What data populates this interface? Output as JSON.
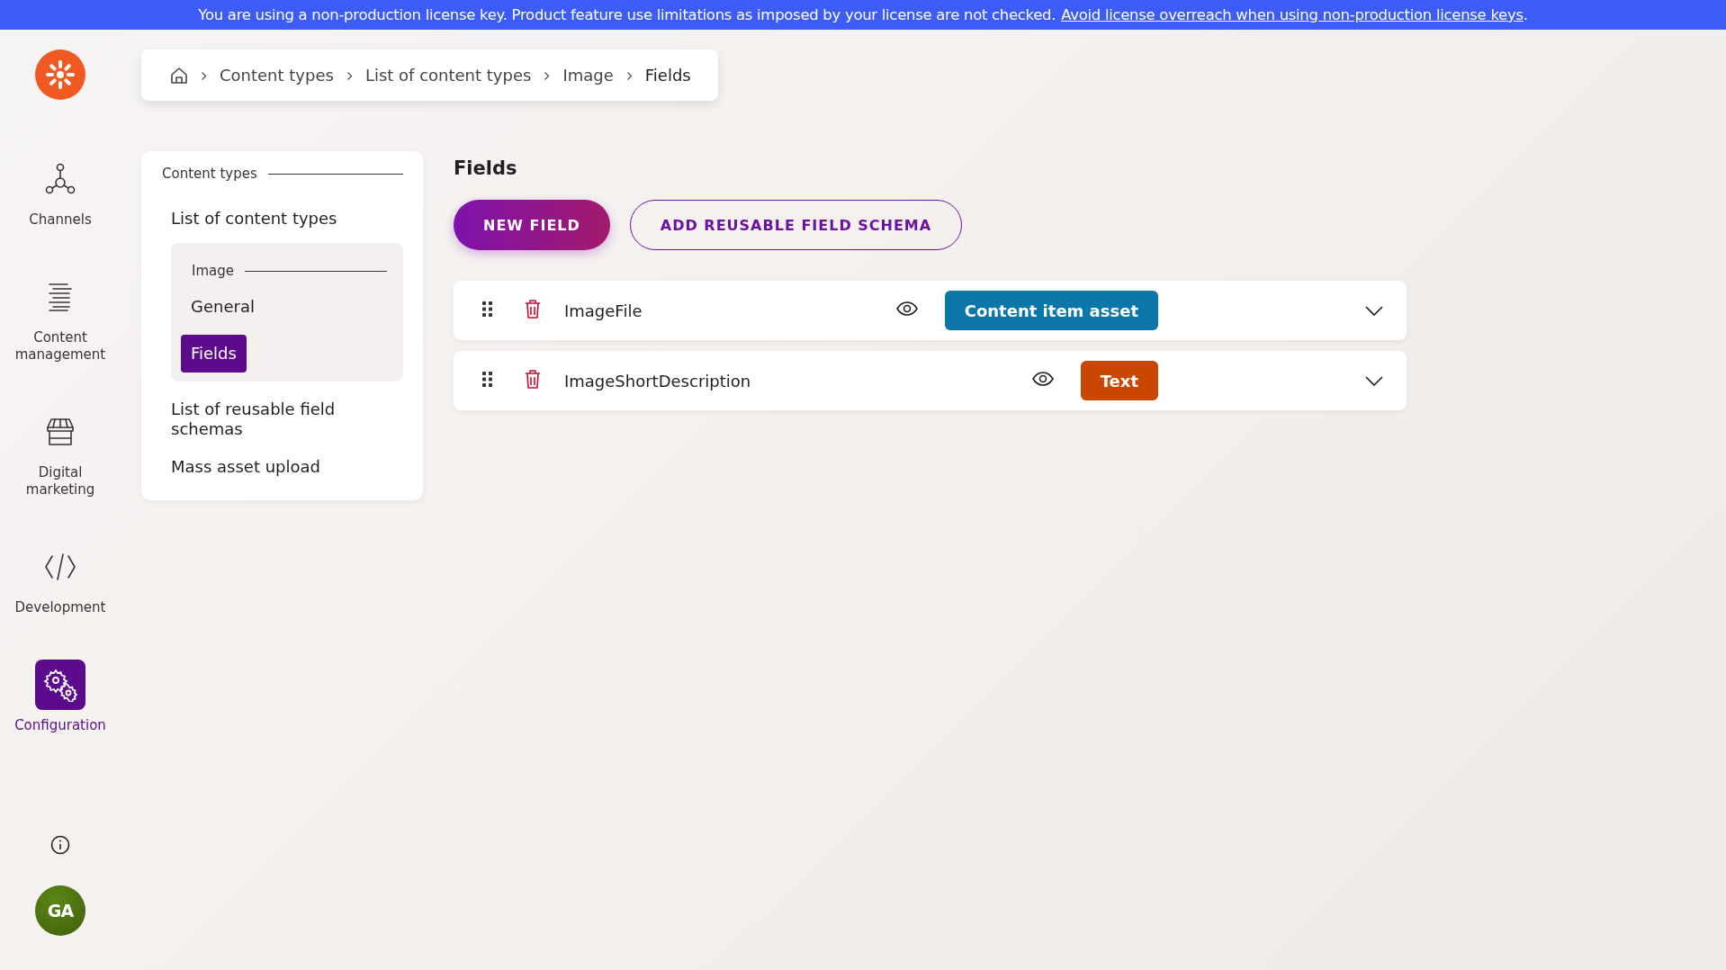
{
  "banner": {
    "message": "You are using a non-production license key. Product feature use limitations as imposed by your license are not checked.",
    "link": "Avoid license overreach when using non-production license keys",
    "end": "."
  },
  "sidebar": {
    "items": [
      {
        "label": "Channels",
        "selected": false
      },
      {
        "label": "Content management",
        "selected": false
      },
      {
        "label": "Digital marketing",
        "selected": false
      },
      {
        "label": "Development",
        "selected": false
      },
      {
        "label": "Configuration",
        "selected": true
      }
    ],
    "avatar": "GA"
  },
  "breadcrumb": [
    {
      "label": "Content types",
      "current": false
    },
    {
      "label": "List of content types",
      "current": false
    },
    {
      "label": "Image",
      "current": false
    },
    {
      "label": "Fields",
      "current": true
    }
  ],
  "nav": {
    "section": "Content types",
    "items": [
      {
        "label": "List of content types"
      },
      {
        "label": "Image",
        "children": [
          {
            "label": "General",
            "selected": false
          },
          {
            "label": "Fields",
            "selected": true
          }
        ]
      },
      {
        "label": "List of reusable field schemas"
      },
      {
        "label": "Mass asset upload"
      }
    ]
  },
  "content": {
    "title": "Fields",
    "buttons": [
      {
        "label": "NEW FIELD",
        "kind": "primary"
      },
      {
        "label": "ADD REUSABLE FIELD SCHEMA",
        "kind": "outline"
      }
    ],
    "fields": [
      {
        "name": "ImageFile",
        "type": "Content item asset",
        "color": "#0b76a8"
      },
      {
        "name": "ImageShortDescription",
        "type": "Text",
        "color": "#c94700"
      }
    ]
  }
}
